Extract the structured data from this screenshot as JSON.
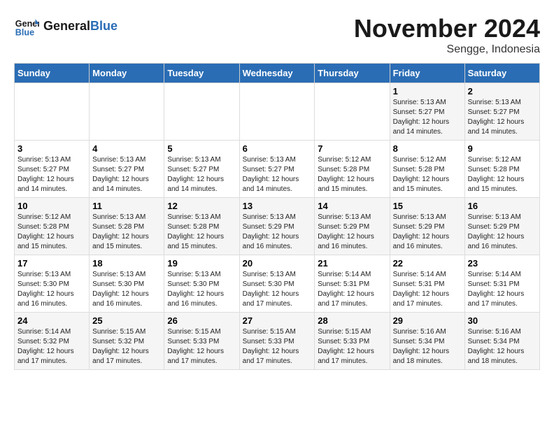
{
  "logo": {
    "name_part1": "General",
    "name_part2": "Blue"
  },
  "title": "November 2024",
  "subtitle": "Sengge, Indonesia",
  "days_of_week": [
    "Sunday",
    "Monday",
    "Tuesday",
    "Wednesday",
    "Thursday",
    "Friday",
    "Saturday"
  ],
  "weeks": [
    [
      {
        "day": "",
        "info": ""
      },
      {
        "day": "",
        "info": ""
      },
      {
        "day": "",
        "info": ""
      },
      {
        "day": "",
        "info": ""
      },
      {
        "day": "",
        "info": ""
      },
      {
        "day": "1",
        "info": "Sunrise: 5:13 AM\nSunset: 5:27 PM\nDaylight: 12 hours\nand 14 minutes."
      },
      {
        "day": "2",
        "info": "Sunrise: 5:13 AM\nSunset: 5:27 PM\nDaylight: 12 hours\nand 14 minutes."
      }
    ],
    [
      {
        "day": "3",
        "info": "Sunrise: 5:13 AM\nSunset: 5:27 PM\nDaylight: 12 hours\nand 14 minutes."
      },
      {
        "day": "4",
        "info": "Sunrise: 5:13 AM\nSunset: 5:27 PM\nDaylight: 12 hours\nand 14 minutes."
      },
      {
        "day": "5",
        "info": "Sunrise: 5:13 AM\nSunset: 5:27 PM\nDaylight: 12 hours\nand 14 minutes."
      },
      {
        "day": "6",
        "info": "Sunrise: 5:13 AM\nSunset: 5:27 PM\nDaylight: 12 hours\nand 14 minutes."
      },
      {
        "day": "7",
        "info": "Sunrise: 5:12 AM\nSunset: 5:28 PM\nDaylight: 12 hours\nand 15 minutes."
      },
      {
        "day": "8",
        "info": "Sunrise: 5:12 AM\nSunset: 5:28 PM\nDaylight: 12 hours\nand 15 minutes."
      },
      {
        "day": "9",
        "info": "Sunrise: 5:12 AM\nSunset: 5:28 PM\nDaylight: 12 hours\nand 15 minutes."
      }
    ],
    [
      {
        "day": "10",
        "info": "Sunrise: 5:12 AM\nSunset: 5:28 PM\nDaylight: 12 hours\nand 15 minutes."
      },
      {
        "day": "11",
        "info": "Sunrise: 5:13 AM\nSunset: 5:28 PM\nDaylight: 12 hours\nand 15 minutes."
      },
      {
        "day": "12",
        "info": "Sunrise: 5:13 AM\nSunset: 5:28 PM\nDaylight: 12 hours\nand 15 minutes."
      },
      {
        "day": "13",
        "info": "Sunrise: 5:13 AM\nSunset: 5:29 PM\nDaylight: 12 hours\nand 16 minutes."
      },
      {
        "day": "14",
        "info": "Sunrise: 5:13 AM\nSunset: 5:29 PM\nDaylight: 12 hours\nand 16 minutes."
      },
      {
        "day": "15",
        "info": "Sunrise: 5:13 AM\nSunset: 5:29 PM\nDaylight: 12 hours\nand 16 minutes."
      },
      {
        "day": "16",
        "info": "Sunrise: 5:13 AM\nSunset: 5:29 PM\nDaylight: 12 hours\nand 16 minutes."
      }
    ],
    [
      {
        "day": "17",
        "info": "Sunrise: 5:13 AM\nSunset: 5:30 PM\nDaylight: 12 hours\nand 16 minutes."
      },
      {
        "day": "18",
        "info": "Sunrise: 5:13 AM\nSunset: 5:30 PM\nDaylight: 12 hours\nand 16 minutes."
      },
      {
        "day": "19",
        "info": "Sunrise: 5:13 AM\nSunset: 5:30 PM\nDaylight: 12 hours\nand 16 minutes."
      },
      {
        "day": "20",
        "info": "Sunrise: 5:13 AM\nSunset: 5:30 PM\nDaylight: 12 hours\nand 17 minutes."
      },
      {
        "day": "21",
        "info": "Sunrise: 5:14 AM\nSunset: 5:31 PM\nDaylight: 12 hours\nand 17 minutes."
      },
      {
        "day": "22",
        "info": "Sunrise: 5:14 AM\nSunset: 5:31 PM\nDaylight: 12 hours\nand 17 minutes."
      },
      {
        "day": "23",
        "info": "Sunrise: 5:14 AM\nSunset: 5:31 PM\nDaylight: 12 hours\nand 17 minutes."
      }
    ],
    [
      {
        "day": "24",
        "info": "Sunrise: 5:14 AM\nSunset: 5:32 PM\nDaylight: 12 hours\nand 17 minutes."
      },
      {
        "day": "25",
        "info": "Sunrise: 5:15 AM\nSunset: 5:32 PM\nDaylight: 12 hours\nand 17 minutes."
      },
      {
        "day": "26",
        "info": "Sunrise: 5:15 AM\nSunset: 5:33 PM\nDaylight: 12 hours\nand 17 minutes."
      },
      {
        "day": "27",
        "info": "Sunrise: 5:15 AM\nSunset: 5:33 PM\nDaylight: 12 hours\nand 17 minutes."
      },
      {
        "day": "28",
        "info": "Sunrise: 5:15 AM\nSunset: 5:33 PM\nDaylight: 12 hours\nand 17 minutes."
      },
      {
        "day": "29",
        "info": "Sunrise: 5:16 AM\nSunset: 5:34 PM\nDaylight: 12 hours\nand 18 minutes."
      },
      {
        "day": "30",
        "info": "Sunrise: 5:16 AM\nSunset: 5:34 PM\nDaylight: 12 hours\nand 18 minutes."
      }
    ]
  ]
}
